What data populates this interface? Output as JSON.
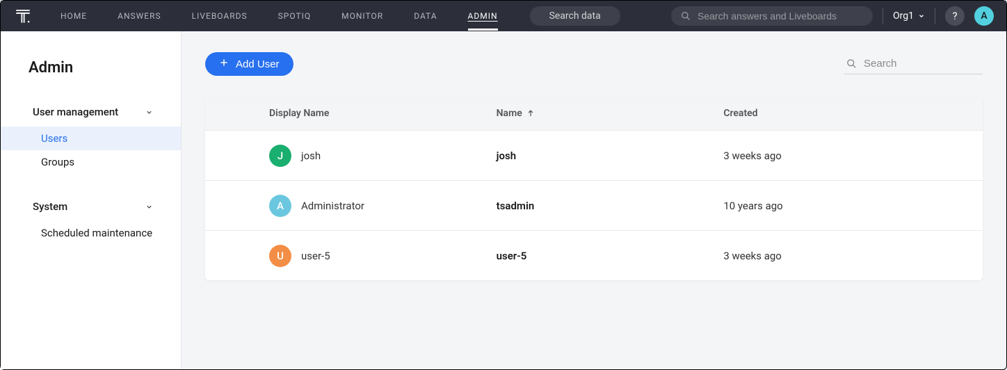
{
  "topbar": {
    "nav": [
      "HOME",
      "ANSWERS",
      "LIVEBOARDS",
      "SPOTIQ",
      "MONITOR",
      "DATA",
      "ADMIN"
    ],
    "activeNav": "ADMIN",
    "searchData": "Search data",
    "searchAnswersPlaceholder": "Search answers and Liveboards",
    "org": "Org1",
    "helpLabel": "?",
    "avatarLetter": "A"
  },
  "sidebar": {
    "title": "Admin",
    "sections": [
      {
        "label": "User management",
        "items": [
          "Users",
          "Groups"
        ],
        "activeItem": "Users"
      },
      {
        "label": "System",
        "items": [
          "Scheduled maintenance"
        ]
      }
    ]
  },
  "main": {
    "addUserLabel": "Add User",
    "tableSearchPlaceholder": "Search",
    "columns": {
      "displayName": "Display Name",
      "name": "Name",
      "created": "Created"
    },
    "sortColumn": "name",
    "rows": [
      {
        "avatarLetter": "J",
        "avatarColor": "green",
        "displayName": "josh",
        "name": "josh",
        "created": "3 weeks ago"
      },
      {
        "avatarLetter": "A",
        "avatarColor": "cyan",
        "displayName": "Administrator",
        "name": "tsadmin",
        "created": "10 years ago"
      },
      {
        "avatarLetter": "U",
        "avatarColor": "orange",
        "displayName": "user-5",
        "name": "user-5",
        "created": "3 weeks ago"
      }
    ]
  }
}
